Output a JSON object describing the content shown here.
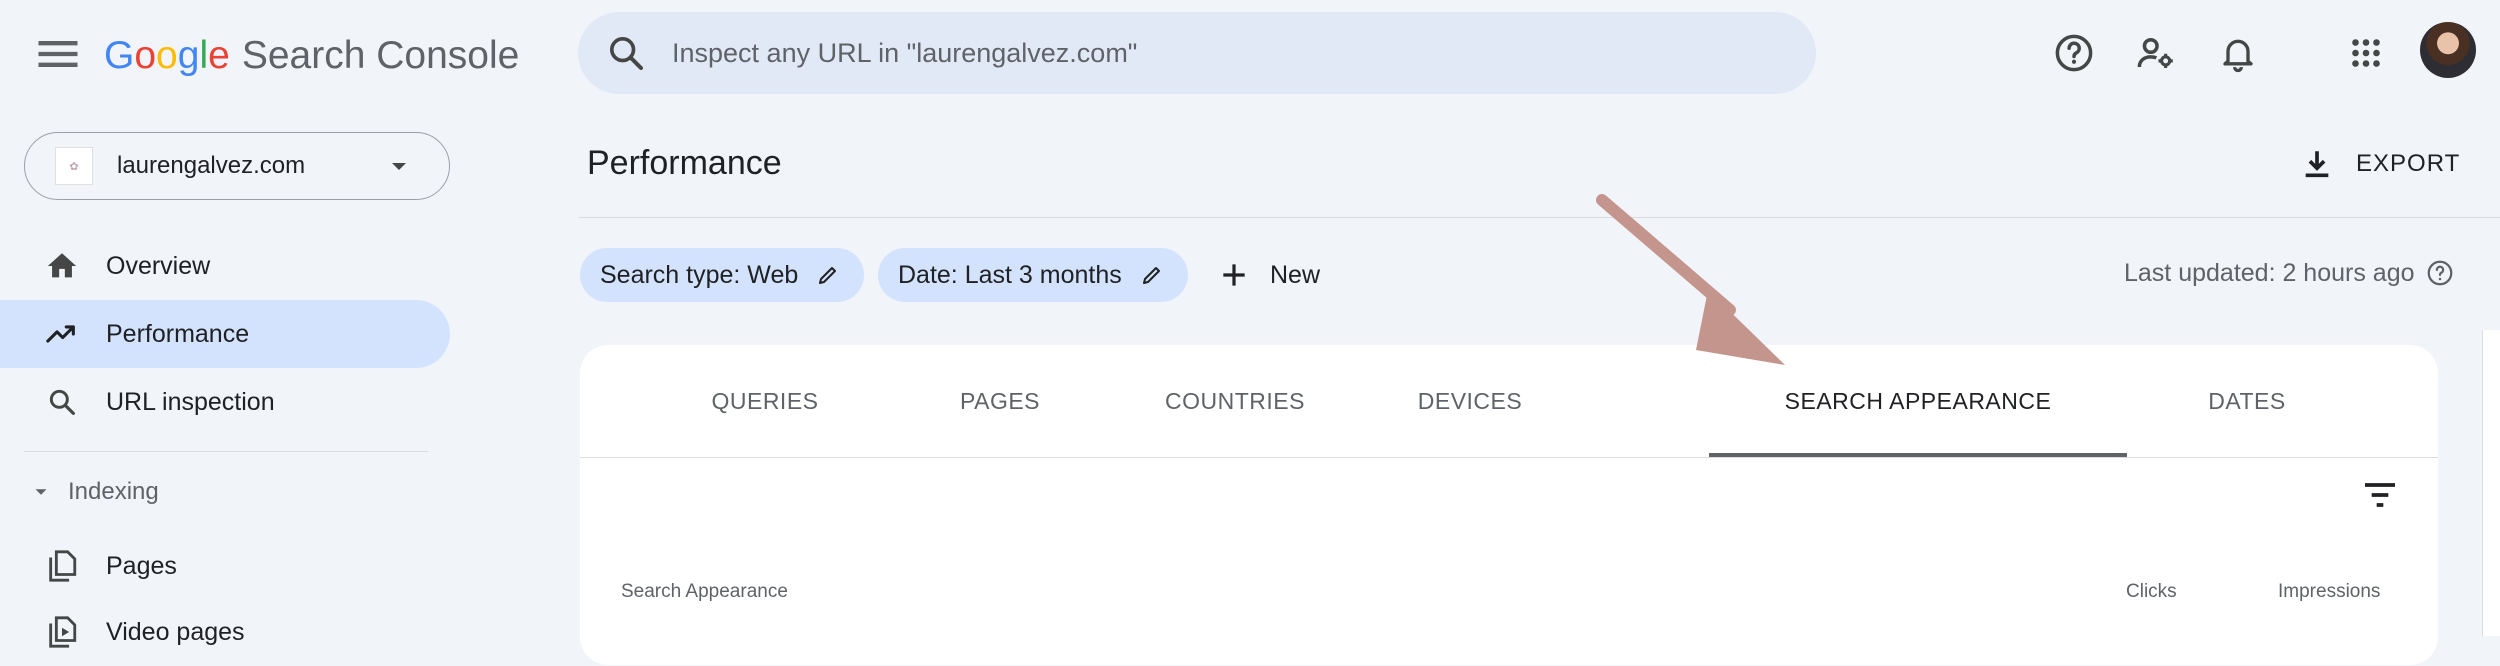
{
  "header": {
    "logo_word": [
      "G",
      "o",
      "o",
      "g",
      "l",
      "e"
    ],
    "product": "Search Console",
    "search_placeholder": "Inspect any URL in \"laurengalvez.com\"",
    "icons": [
      "help-icon",
      "manage-users-icon",
      "notifications-icon",
      "apps-grid-icon"
    ]
  },
  "sidebar": {
    "property": "laurengalvez.com",
    "nav": [
      {
        "label": "Overview",
        "icon": "home-icon",
        "active": false
      },
      {
        "label": "Performance",
        "icon": "trending-up-icon",
        "active": true
      },
      {
        "label": "URL inspection",
        "icon": "search-icon",
        "active": false
      }
    ],
    "section_label": "Indexing",
    "sub_items": [
      {
        "label": "Pages",
        "icon": "pages-icon"
      },
      {
        "label": "Video pages",
        "icon": "video-pages-icon"
      }
    ]
  },
  "main": {
    "title": "Performance",
    "export_label": "EXPORT",
    "chips": [
      {
        "label": "Search type: Web"
      },
      {
        "label": "Date: Last 3 months"
      }
    ],
    "new_label": "New",
    "last_updated": "Last updated: 2 hours ago"
  },
  "tabs": [
    {
      "label": "QUERIES",
      "active": false
    },
    {
      "label": "PAGES",
      "active": false
    },
    {
      "label": "COUNTRIES",
      "active": false
    },
    {
      "label": "DEVICES",
      "active": false
    },
    {
      "label": "SEARCH APPEARANCE",
      "active": true
    },
    {
      "label": "DATES",
      "active": false
    }
  ],
  "table": {
    "columns": [
      "Search Appearance",
      "Clicks",
      "Impressions"
    ]
  },
  "colors": {
    "page_bg": "#f1f4f9",
    "active_chip": "#d3e3fd",
    "annotation_arrow": "#c4958d"
  }
}
